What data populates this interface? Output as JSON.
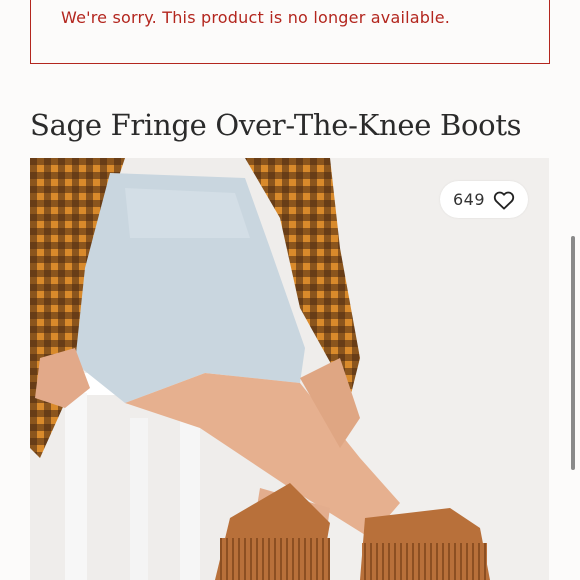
{
  "alert": {
    "message": "We're sorry. This product is no longer available."
  },
  "product": {
    "title": "Sage Fringe Over-The-Knee Boots",
    "likes": "649",
    "icons": {
      "like": "heart-outline-icon"
    }
  },
  "colors": {
    "alert_red": "#b3261e",
    "title_text": "#2b2b2b",
    "page_bg": "#fcfbfa"
  }
}
